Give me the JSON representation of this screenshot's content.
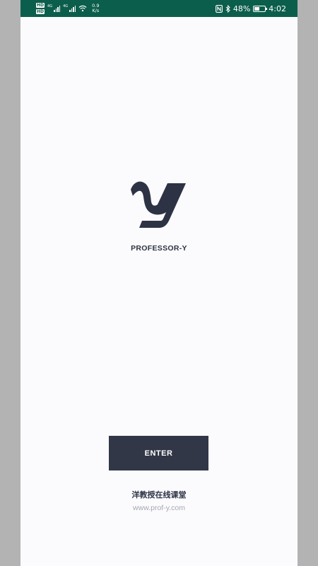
{
  "status_bar": {
    "network_speed_value": "0.9",
    "network_speed_unit": "K/s",
    "battery_percent": "48%",
    "battery_level": 0.48,
    "time": "4:02",
    "icons": [
      "hd-icon",
      "signal-4g-icon",
      "wifi-icon",
      "nfc-icon",
      "bluetooth-icon",
      "battery-icon"
    ]
  },
  "app": {
    "logo": "professor-y-logo",
    "name": "PROFESSOR-Y",
    "enter_label": "ENTER",
    "tagline": "洋教授在线课堂",
    "website": "www.prof-y.com"
  },
  "colors": {
    "status_bar": "#0c5e4c",
    "background": "#fbfbfd",
    "accent": "#313747",
    "text": "#2d3344",
    "muted": "#a5a8b0"
  }
}
